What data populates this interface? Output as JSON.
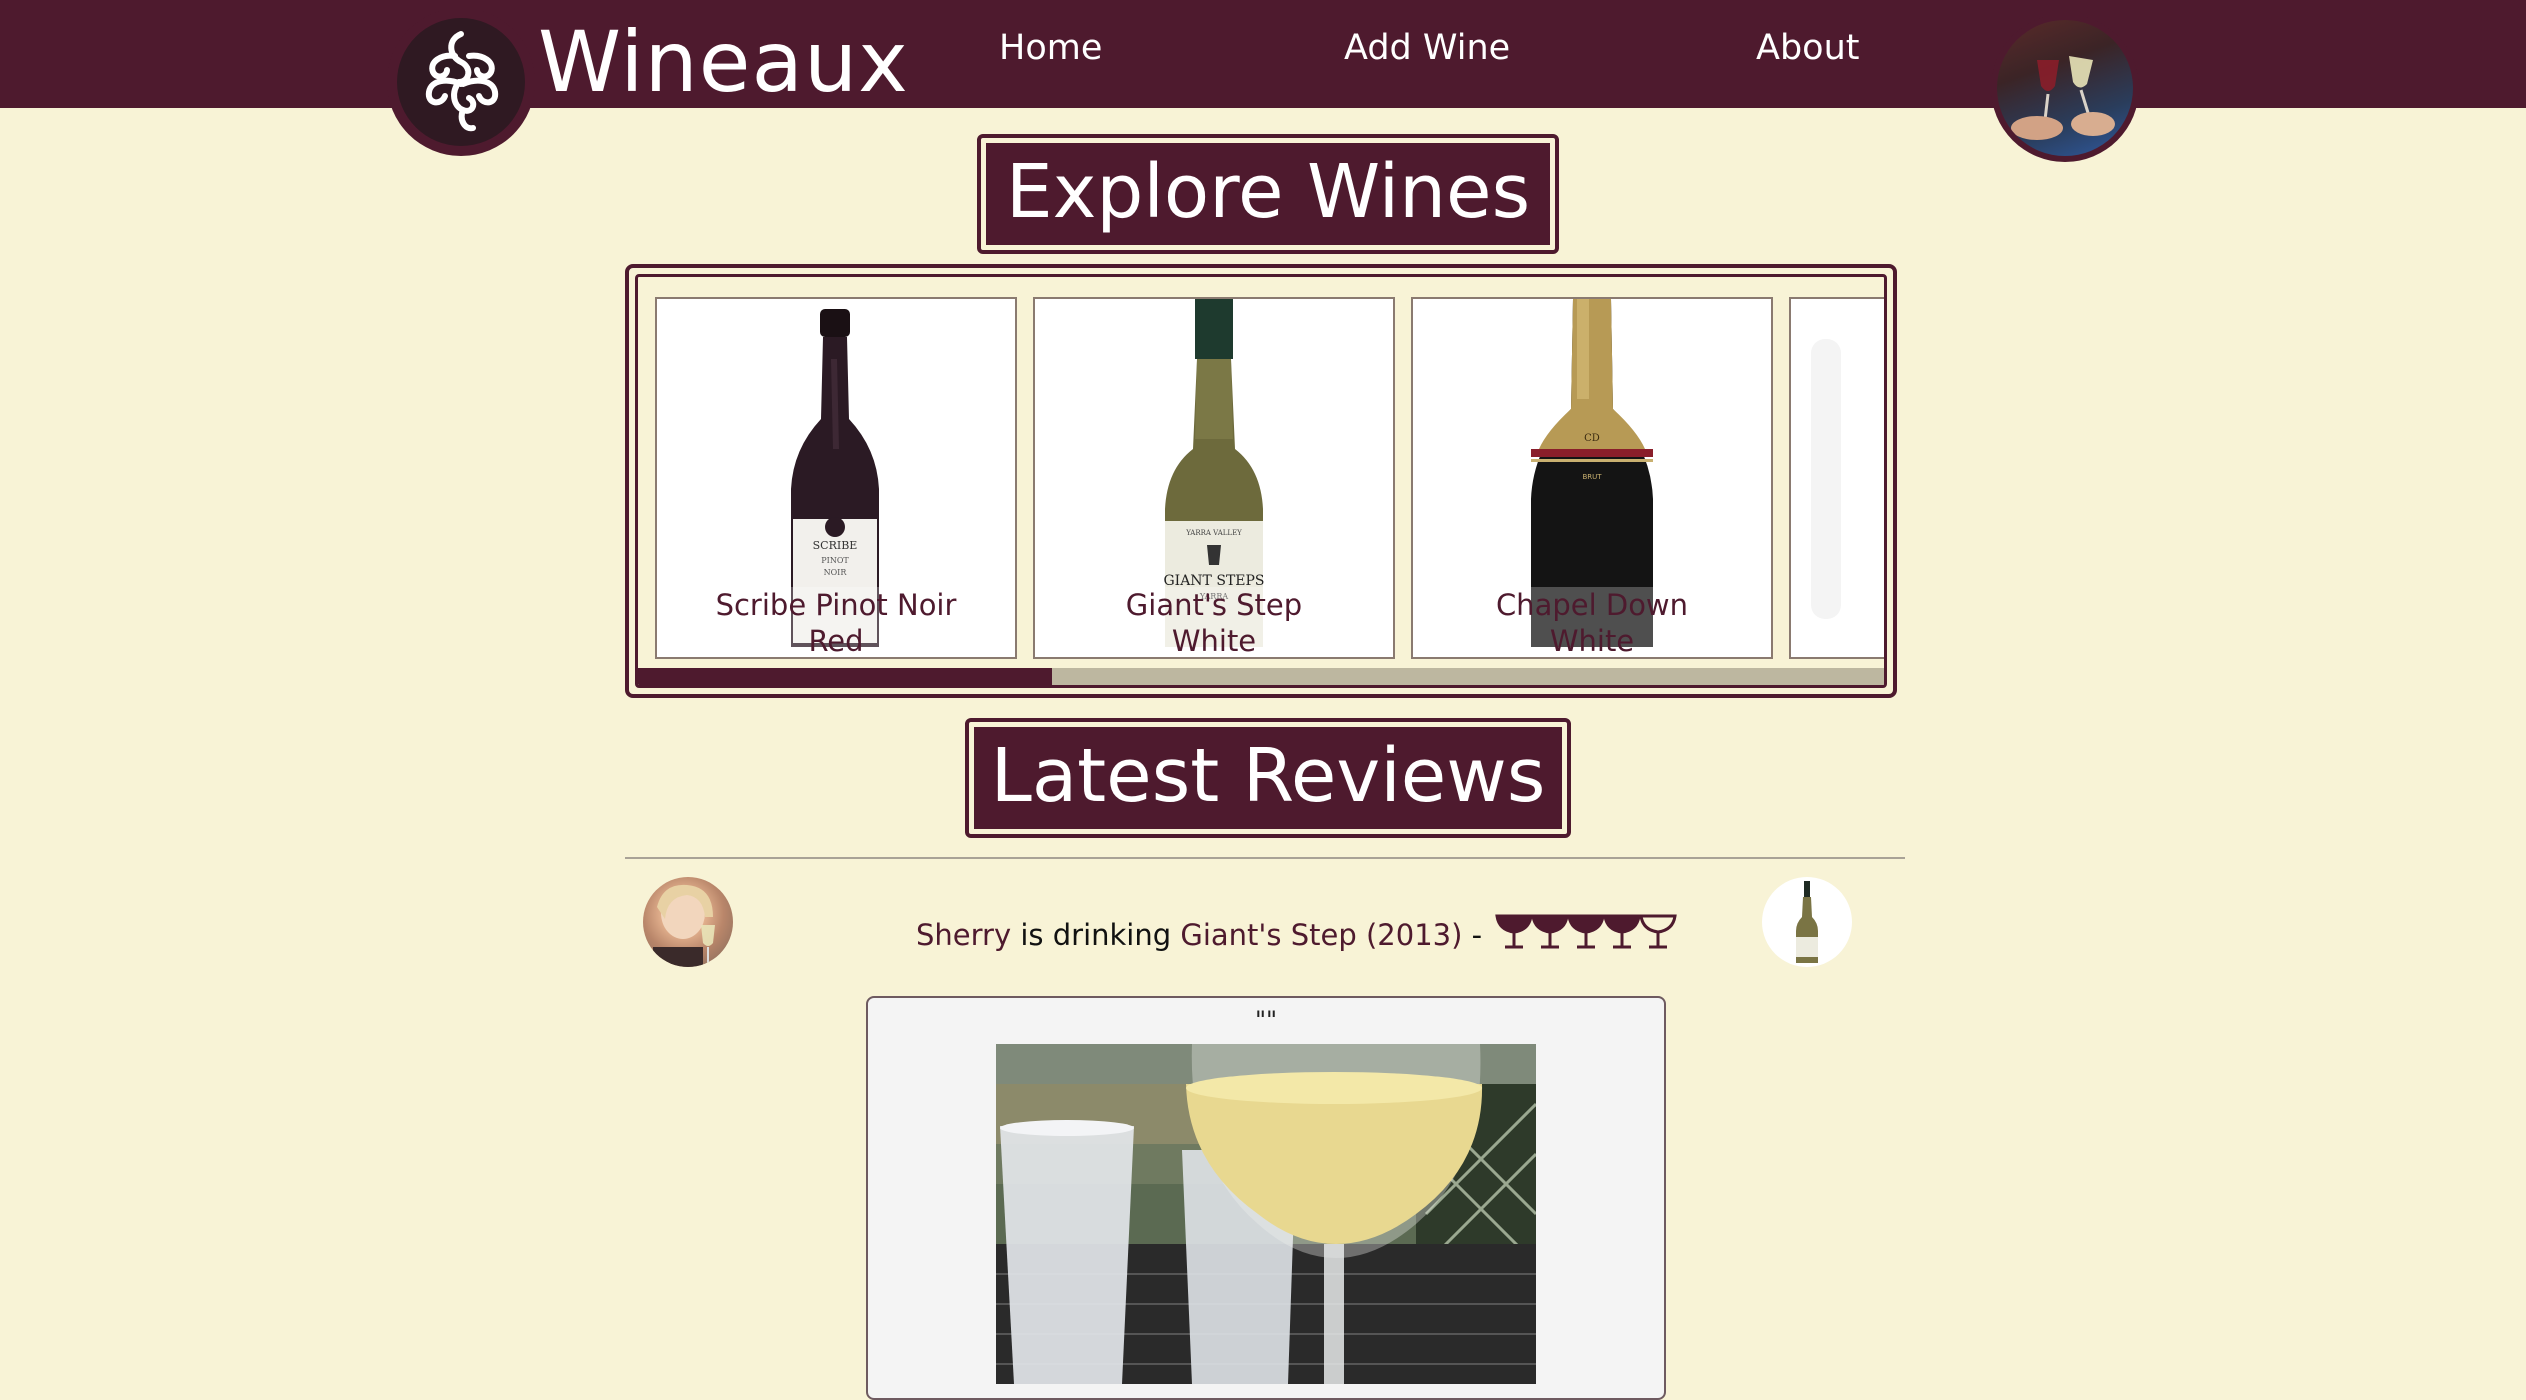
{
  "header": {
    "brand": "Wineaux",
    "nav": [
      {
        "label": "Home"
      },
      {
        "label": "Add Wine"
      },
      {
        "label": "About"
      }
    ],
    "logo_icon": "swirl-logo-icon",
    "profile_icon": "profile-avatar"
  },
  "explore": {
    "title": "Explore Wines",
    "wines": [
      {
        "name_line1": "Scribe Pinot Noir",
        "name_line2": "Red"
      },
      {
        "name_line1": "Giant's Step",
        "name_line2": "White"
      },
      {
        "name_line1": "Chapel Down",
        "name_line2": "White"
      }
    ]
  },
  "reviews": {
    "title": "Latest Reviews",
    "items": [
      {
        "user": "Sherry",
        "verb": " is drinking ",
        "wine": "Giant's Step (2013)",
        "dash": " -",
        "rating": 4,
        "rating_max": 5,
        "text": "\"\""
      }
    ]
  },
  "colors": {
    "brand": "#4e1a2e",
    "background": "#f8f3d6",
    "track": "#bdb7a0"
  }
}
